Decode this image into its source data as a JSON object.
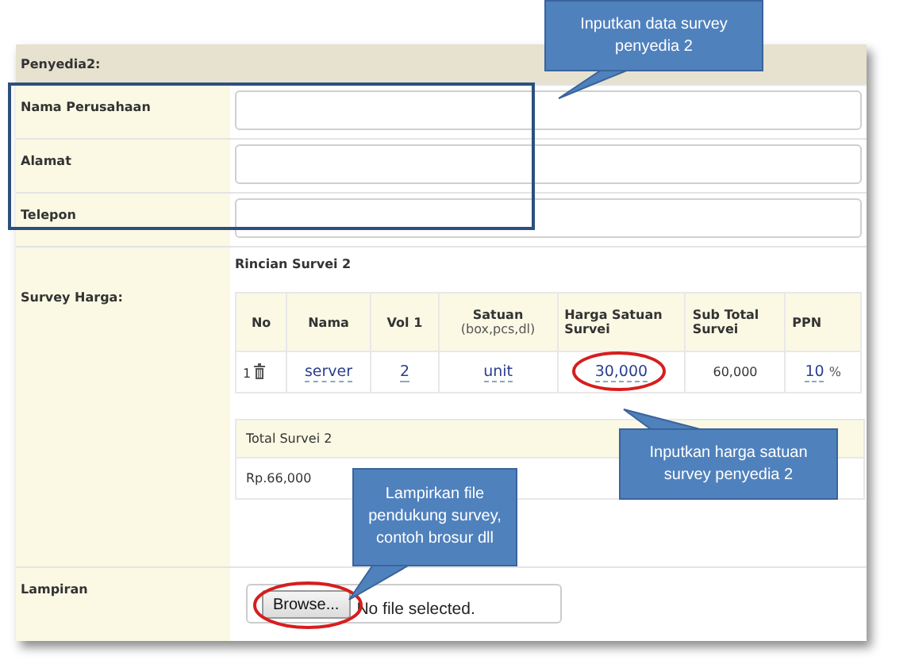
{
  "section_title": "Penyedia2:",
  "fields": [
    {
      "label": "Nama Perusahaan"
    },
    {
      "label": "Alamat"
    },
    {
      "label": "Telepon"
    }
  ],
  "survey": {
    "label": "Survey Harga:",
    "subtitle": "Rincian Survei 2",
    "columns": [
      {
        "label": "No"
      },
      {
        "label": "Nama"
      },
      {
        "label": "Vol 1"
      },
      {
        "label": "Satuan",
        "sublabel": "(box,pcs,dl)"
      },
      {
        "label": "Harga Satuan Survei"
      },
      {
        "label": "Sub Total Survei"
      },
      {
        "label": "PPN"
      }
    ],
    "row": [
      {
        "text": "1",
        "kind": "number"
      },
      {
        "text": "server",
        "kind": "editable"
      },
      {
        "text": "2",
        "kind": "editable"
      },
      {
        "text": "unit",
        "kind": "editable"
      },
      {
        "text": "30,000",
        "kind": "editable"
      },
      {
        "text": "60,000",
        "kind": "plain"
      },
      {
        "text": "10",
        "kind": "editable",
        "suffix": "%"
      }
    ],
    "total_label": "Total Survei 2",
    "total_value": "Rp.66,000"
  },
  "attachment": {
    "label": "Lampiran",
    "button": "Browse...",
    "status": "No file selected."
  },
  "callouts": [
    {
      "text": "Inputkan data survey penyedia 2"
    },
    {
      "text": "Inputkan harga satuan survey penyedia 2"
    },
    {
      "text": "Lampirkan file pendukung survey, contoh brosur dll"
    }
  ]
}
